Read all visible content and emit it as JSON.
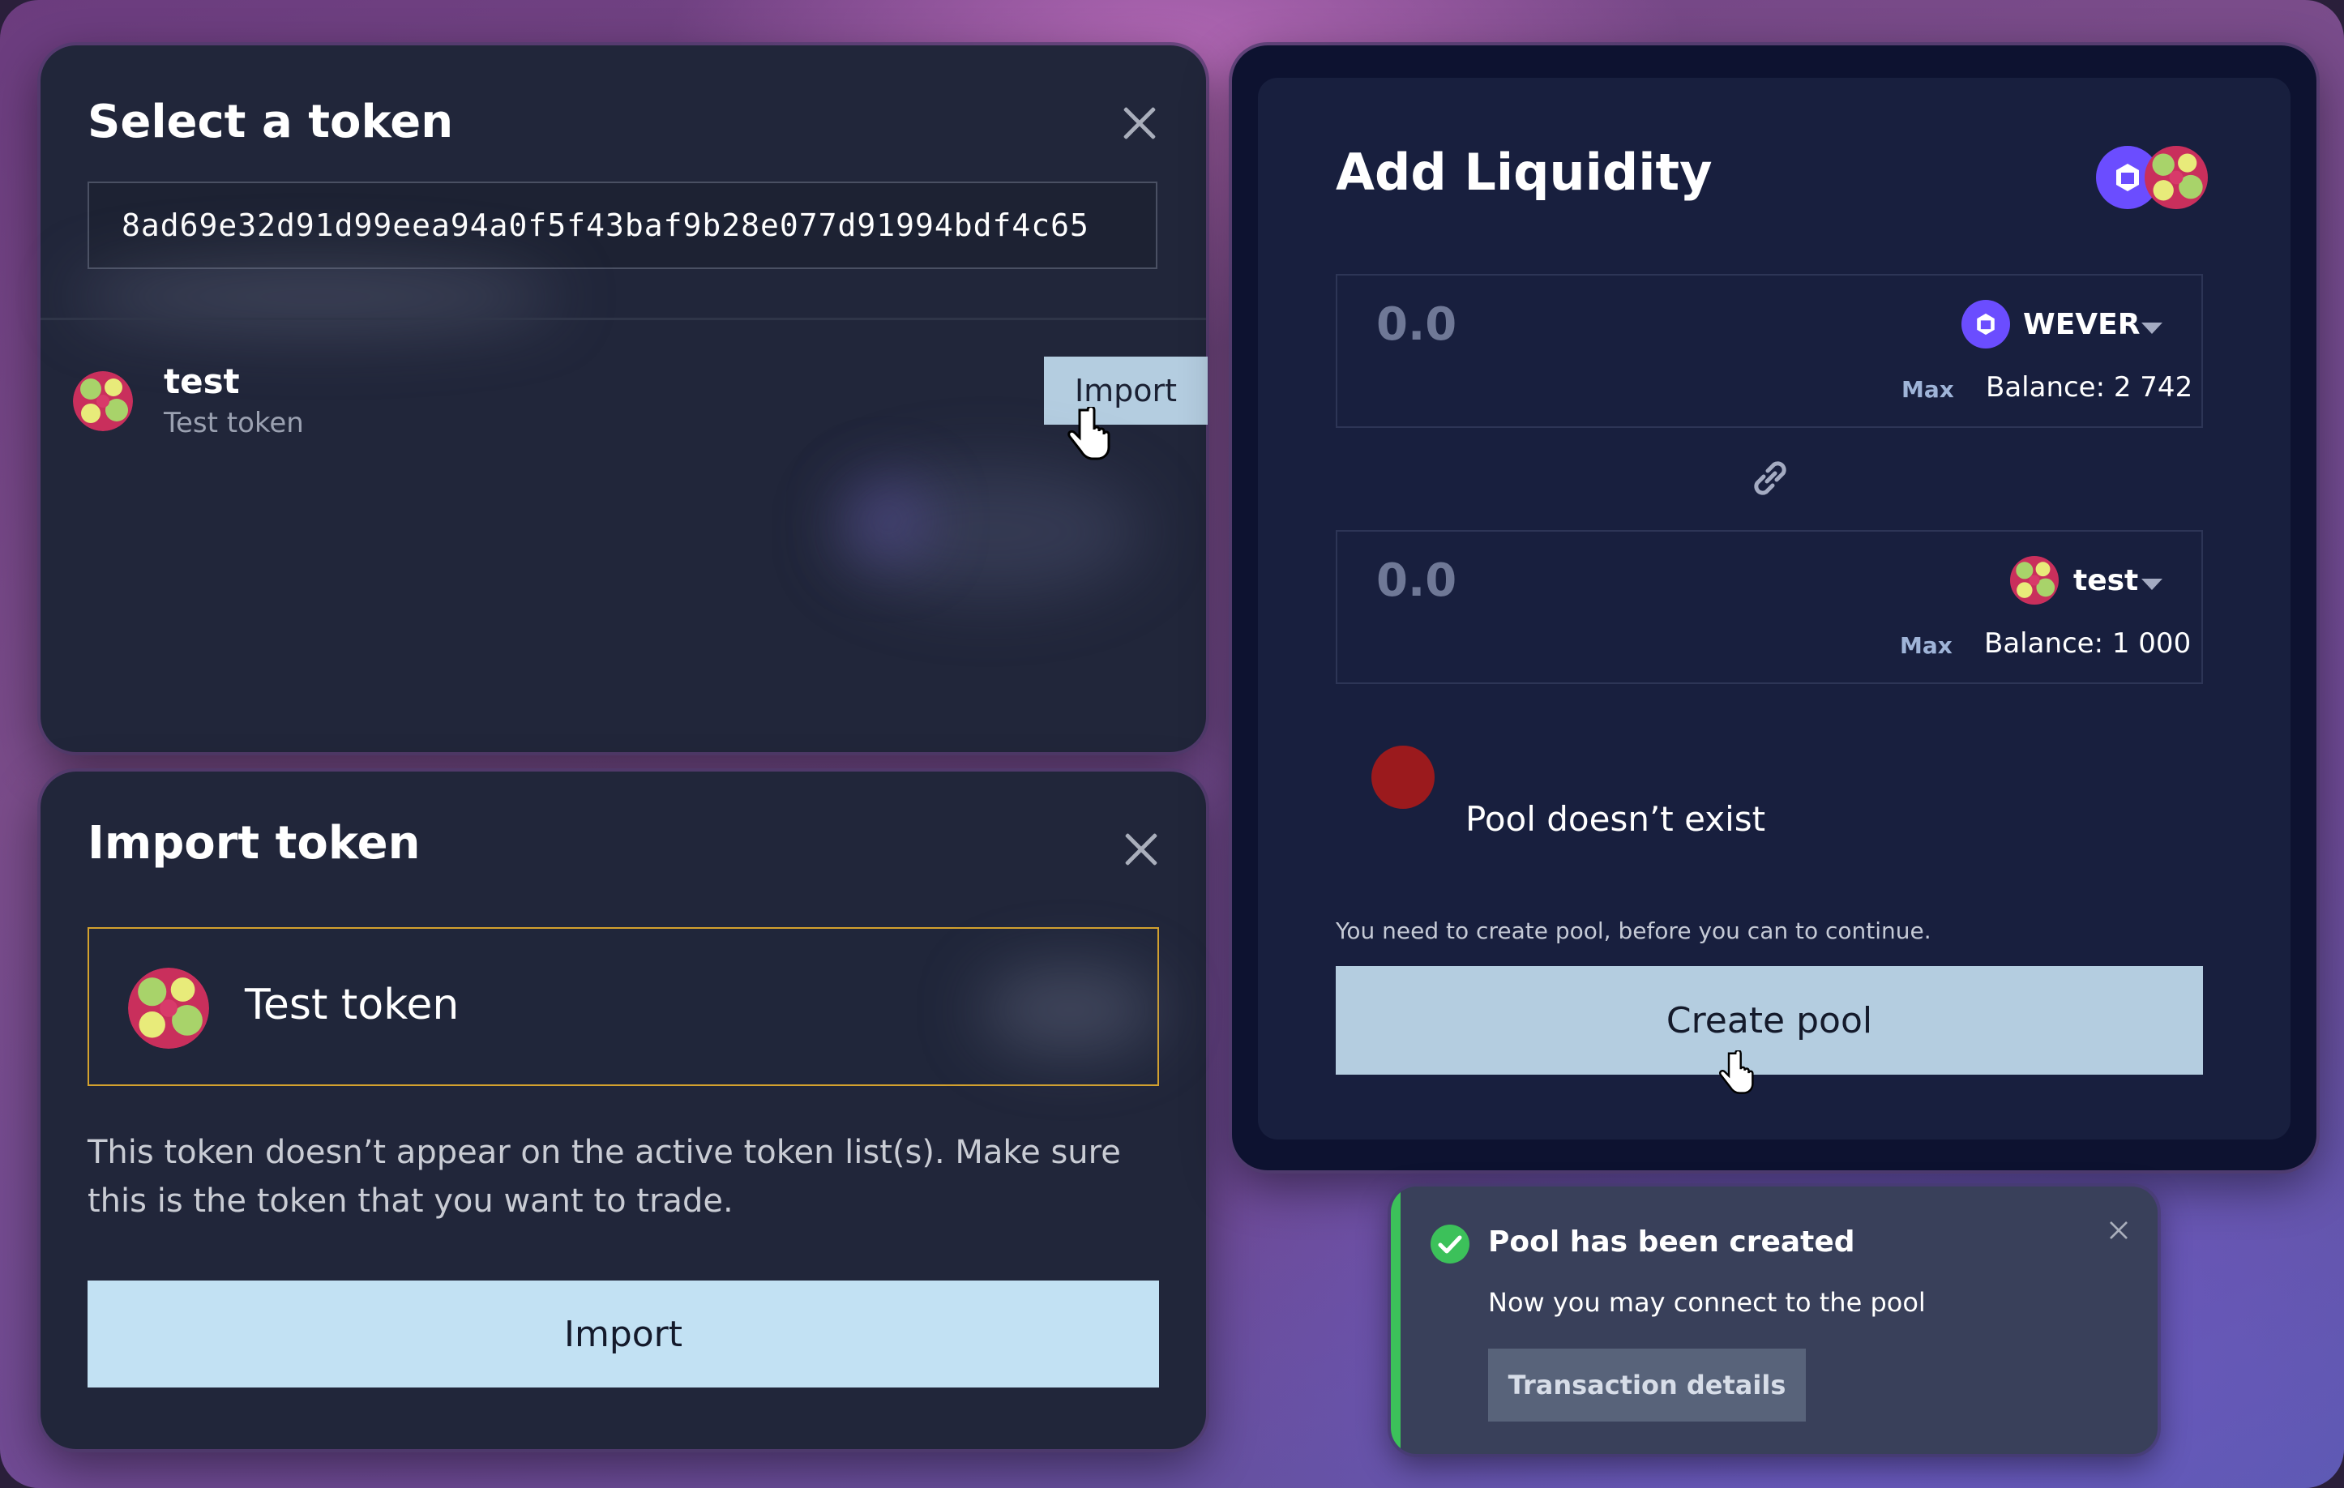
{
  "select_token": {
    "title": "Select a token",
    "search_value": "8ad69e32d91d99eea94a0f5f43baf9b28e077d91994bdf4c65",
    "result": {
      "symbol": "test",
      "name": "Test token",
      "import_label": "Import"
    }
  },
  "import_token": {
    "title": "Import token",
    "token_name": "Test token",
    "warning": "This token doesn’t appear on the active token list(s). Make sure this is the token that you want to trade.",
    "import_label": "Import"
  },
  "add_liquidity": {
    "title": "Add Liquidity",
    "left": {
      "amount": "0.0",
      "symbol": "WEVER",
      "max_label": "Max",
      "balance": "Balance: 2 742"
    },
    "right": {
      "amount": "0.0",
      "symbol": "test",
      "max_label": "Max",
      "balance": "Balance: 1 000"
    },
    "pool_status": "Pool doesn’t exist",
    "hint": "You need to create pool, before you can to continue.",
    "create_label": "Create pool",
    "status_color": "#9b1a1d"
  },
  "toast": {
    "title": "Pool has been created",
    "message": "Now you may connect to the pool",
    "action_label": "Transaction details",
    "accent_color": "#3cc15a"
  },
  "icons": [
    "close-icon",
    "token-avatar-icon",
    "wever-icon",
    "link-icon",
    "chevron-down-icon",
    "check-circle-icon",
    "cursor-icon"
  ]
}
